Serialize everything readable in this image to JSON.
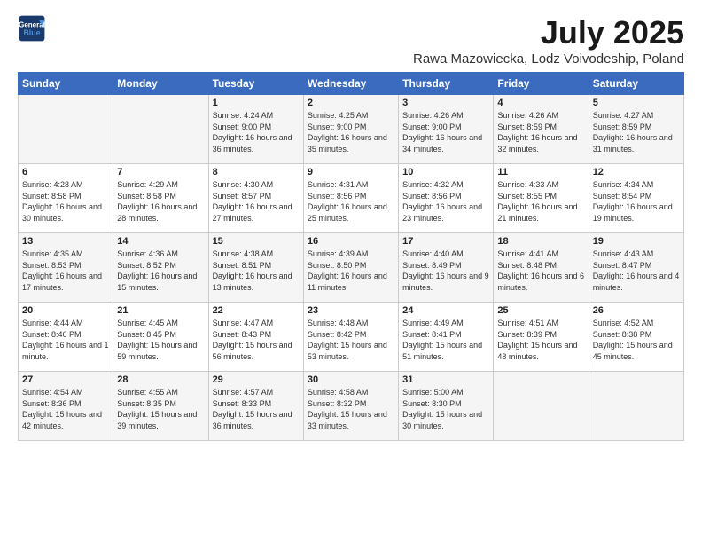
{
  "header": {
    "logo_line1": "General",
    "logo_line2": "Blue",
    "title": "July 2025",
    "subtitle": "Rawa Mazowiecka, Lodz Voivodeship, Poland"
  },
  "days_of_week": [
    "Sunday",
    "Monday",
    "Tuesday",
    "Wednesday",
    "Thursday",
    "Friday",
    "Saturday"
  ],
  "weeks": [
    [
      {
        "day": "",
        "detail": ""
      },
      {
        "day": "",
        "detail": ""
      },
      {
        "day": "1",
        "detail": "Sunrise: 4:24 AM\nSunset: 9:00 PM\nDaylight: 16 hours\nand 36 minutes."
      },
      {
        "day": "2",
        "detail": "Sunrise: 4:25 AM\nSunset: 9:00 PM\nDaylight: 16 hours\nand 35 minutes."
      },
      {
        "day": "3",
        "detail": "Sunrise: 4:26 AM\nSunset: 9:00 PM\nDaylight: 16 hours\nand 34 minutes."
      },
      {
        "day": "4",
        "detail": "Sunrise: 4:26 AM\nSunset: 8:59 PM\nDaylight: 16 hours\nand 32 minutes."
      },
      {
        "day": "5",
        "detail": "Sunrise: 4:27 AM\nSunset: 8:59 PM\nDaylight: 16 hours\nand 31 minutes."
      }
    ],
    [
      {
        "day": "6",
        "detail": "Sunrise: 4:28 AM\nSunset: 8:58 PM\nDaylight: 16 hours\nand 30 minutes."
      },
      {
        "day": "7",
        "detail": "Sunrise: 4:29 AM\nSunset: 8:58 PM\nDaylight: 16 hours\nand 28 minutes."
      },
      {
        "day": "8",
        "detail": "Sunrise: 4:30 AM\nSunset: 8:57 PM\nDaylight: 16 hours\nand 27 minutes."
      },
      {
        "day": "9",
        "detail": "Sunrise: 4:31 AM\nSunset: 8:56 PM\nDaylight: 16 hours\nand 25 minutes."
      },
      {
        "day": "10",
        "detail": "Sunrise: 4:32 AM\nSunset: 8:56 PM\nDaylight: 16 hours\nand 23 minutes."
      },
      {
        "day": "11",
        "detail": "Sunrise: 4:33 AM\nSunset: 8:55 PM\nDaylight: 16 hours\nand 21 minutes."
      },
      {
        "day": "12",
        "detail": "Sunrise: 4:34 AM\nSunset: 8:54 PM\nDaylight: 16 hours\nand 19 minutes."
      }
    ],
    [
      {
        "day": "13",
        "detail": "Sunrise: 4:35 AM\nSunset: 8:53 PM\nDaylight: 16 hours\nand 17 minutes."
      },
      {
        "day": "14",
        "detail": "Sunrise: 4:36 AM\nSunset: 8:52 PM\nDaylight: 16 hours\nand 15 minutes."
      },
      {
        "day": "15",
        "detail": "Sunrise: 4:38 AM\nSunset: 8:51 PM\nDaylight: 16 hours\nand 13 minutes."
      },
      {
        "day": "16",
        "detail": "Sunrise: 4:39 AM\nSunset: 8:50 PM\nDaylight: 16 hours\nand 11 minutes."
      },
      {
        "day": "17",
        "detail": "Sunrise: 4:40 AM\nSunset: 8:49 PM\nDaylight: 16 hours\nand 9 minutes."
      },
      {
        "day": "18",
        "detail": "Sunrise: 4:41 AM\nSunset: 8:48 PM\nDaylight: 16 hours\nand 6 minutes."
      },
      {
        "day": "19",
        "detail": "Sunrise: 4:43 AM\nSunset: 8:47 PM\nDaylight: 16 hours\nand 4 minutes."
      }
    ],
    [
      {
        "day": "20",
        "detail": "Sunrise: 4:44 AM\nSunset: 8:46 PM\nDaylight: 16 hours\nand 1 minute."
      },
      {
        "day": "21",
        "detail": "Sunrise: 4:45 AM\nSunset: 8:45 PM\nDaylight: 15 hours\nand 59 minutes."
      },
      {
        "day": "22",
        "detail": "Sunrise: 4:47 AM\nSunset: 8:43 PM\nDaylight: 15 hours\nand 56 minutes."
      },
      {
        "day": "23",
        "detail": "Sunrise: 4:48 AM\nSunset: 8:42 PM\nDaylight: 15 hours\nand 53 minutes."
      },
      {
        "day": "24",
        "detail": "Sunrise: 4:49 AM\nSunset: 8:41 PM\nDaylight: 15 hours\nand 51 minutes."
      },
      {
        "day": "25",
        "detail": "Sunrise: 4:51 AM\nSunset: 8:39 PM\nDaylight: 15 hours\nand 48 minutes."
      },
      {
        "day": "26",
        "detail": "Sunrise: 4:52 AM\nSunset: 8:38 PM\nDaylight: 15 hours\nand 45 minutes."
      }
    ],
    [
      {
        "day": "27",
        "detail": "Sunrise: 4:54 AM\nSunset: 8:36 PM\nDaylight: 15 hours\nand 42 minutes."
      },
      {
        "day": "28",
        "detail": "Sunrise: 4:55 AM\nSunset: 8:35 PM\nDaylight: 15 hours\nand 39 minutes."
      },
      {
        "day": "29",
        "detail": "Sunrise: 4:57 AM\nSunset: 8:33 PM\nDaylight: 15 hours\nand 36 minutes."
      },
      {
        "day": "30",
        "detail": "Sunrise: 4:58 AM\nSunset: 8:32 PM\nDaylight: 15 hours\nand 33 minutes."
      },
      {
        "day": "31",
        "detail": "Sunrise: 5:00 AM\nSunset: 8:30 PM\nDaylight: 15 hours\nand 30 minutes."
      },
      {
        "day": "",
        "detail": ""
      },
      {
        "day": "",
        "detail": ""
      }
    ]
  ]
}
